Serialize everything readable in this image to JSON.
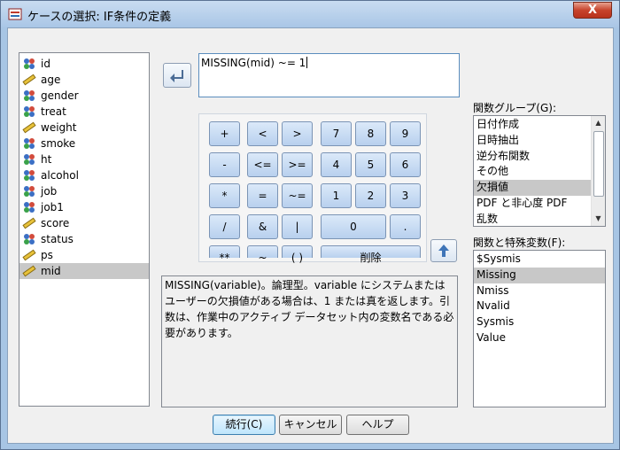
{
  "window": {
    "title": "ケースの選択: IF条件の定義",
    "close_label": "X"
  },
  "variables": [
    {
      "name": "id",
      "type": "nominal"
    },
    {
      "name": "age",
      "type": "scale"
    },
    {
      "name": "gender",
      "type": "nominal"
    },
    {
      "name": "treat",
      "type": "nominal"
    },
    {
      "name": "weight",
      "type": "scale"
    },
    {
      "name": "smoke",
      "type": "nominal"
    },
    {
      "name": "ht",
      "type": "nominal"
    },
    {
      "name": "alcohol",
      "type": "nominal"
    },
    {
      "name": "job",
      "type": "nominal"
    },
    {
      "name": "job1",
      "type": "nominal"
    },
    {
      "name": "score",
      "type": "scale"
    },
    {
      "name": "status",
      "type": "nominal"
    },
    {
      "name": "ps",
      "type": "scale"
    },
    {
      "name": "mid",
      "type": "scale",
      "selected": true
    }
  ],
  "expression": "MISSING(mid) ~= 1",
  "keypad": {
    "plus": "+",
    "lt": "<",
    "gt": ">",
    "k7": "7",
    "k8": "8",
    "k9": "9",
    "minus": "-",
    "le": "<=",
    "ge": ">=",
    "k4": "4",
    "k5": "5",
    "k6": "6",
    "mult": "*",
    "eq": "=",
    "ne": "~=",
    "k1": "1",
    "k2": "2",
    "k3": "3",
    "div": "/",
    "and": "&",
    "or": "|",
    "k0": "0",
    "dot": ".",
    "pow": "**",
    "not": "~",
    "paren": "( )",
    "delete": "削除"
  },
  "description": "MISSING(variable)。論理型。variable にシステムまたはユーザーの欠損値がある場合は、1 または真を返します。引数は、作業中のアクティブ データセット内の変数名である必要があります。",
  "function_groups": {
    "label": "関数グループ(G):",
    "items": [
      "日付作成",
      "日時抽出",
      "逆分布関数",
      "その他",
      "欠損値",
      "PDF と非心度 PDF",
      "乱数"
    ],
    "selected_index": 4
  },
  "functions": {
    "label": "関数と特殊変数(F):",
    "items": [
      "$Sysmis",
      "Missing",
      "Nmiss",
      "Nvalid",
      "Sysmis",
      "Value"
    ],
    "selected_index": 1
  },
  "buttons": {
    "continue": "続行(C)",
    "cancel": "キャンセル",
    "help": "ヘルプ"
  },
  "colors": {
    "accent": "#3c7fb1",
    "selection": "#c8c8c8",
    "title_bar": "#a9c6e6",
    "close": "#c7432c"
  }
}
